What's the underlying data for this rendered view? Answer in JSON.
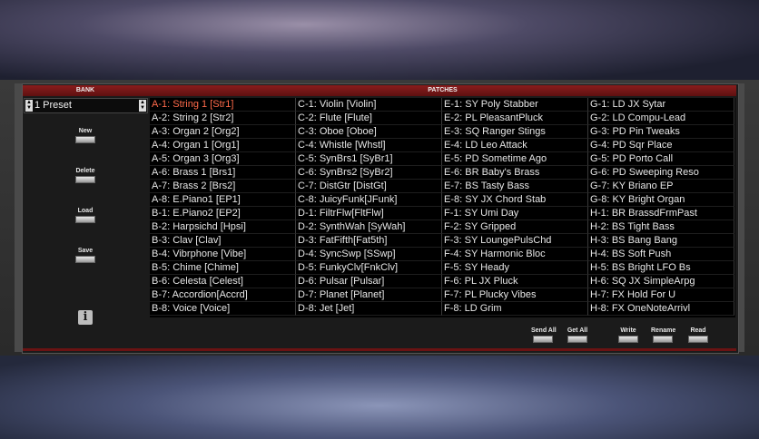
{
  "bank": {
    "header": "BANK",
    "selected_preset": "1 Preset",
    "buttons": {
      "new": "New",
      "delete": "Delete",
      "load": "Load",
      "save": "Save"
    }
  },
  "patches": {
    "header": "PATCHES",
    "selected": "A-1: String 1 [Str1]",
    "columns": [
      [
        "A-1: String 1 [Str1]",
        "A-2: String 2 [Str2]",
        "A-3: Organ 2 [Org2]",
        "A-4: Organ 1 [Org1]",
        "A-5: Organ 3 [Org3]",
        "A-6: Brass 1 [Brs1]",
        "A-7: Brass 2 [Brs2]",
        "A-8: E.Piano1 [EP1]",
        "B-1: E.Piano2 [EP2]",
        "B-2: Harpsichd [Hpsi]",
        "B-3: Clav [Clav]",
        "B-4: Vibrphone [Vibe]",
        "B-5: Chime [Chime]",
        "B-6: Celesta [Celest]",
        "B-7: Accordion[Accrd]",
        "B-8: Voice [Voice]"
      ],
      [
        "C-1: Violin [Violin]",
        "C-2: Flute [Flute]",
        "C-3: Oboe [Oboe]",
        "C-4: Whistle [Whstl]",
        "C-5: SynBrs1 [SyBr1]",
        "C-6: SynBrs2 [SyBr2]",
        "C-7: DistGtr [DistGt]",
        "C-8: JuicyFunk[JFunk]",
        "D-1: FiltrFlw[FltFlw]",
        "D-2: SynthWah [SyWah]",
        "D-3: FatFifth[Fat5th]",
        "D-4: SyncSwp [SSwp]",
        "D-5: FunkyClv[FnkClv]",
        "D-6: Pulsar [Pulsar]",
        "D-7: Planet [Planet]",
        "D-8: Jet [Jet]"
      ],
      [
        "E-1: SY Poly Stabber",
        "E-2: PL PleasantPluck",
        "E-3: SQ Ranger Stings",
        "E-4: LD Leo Attack",
        "E-5: PD Sometime Ago",
        "E-6: BR Baby's Brass",
        "E-7: BS Tasty Bass",
        "E-8: SY JX Chord Stab",
        "F-1: SY Umi Day",
        "F-2: SY Gripped",
        "F-3: SY LoungePulsChd",
        "F-4: SY Harmonic Bloc",
        "F-5: SY Heady",
        "F-6: PL JX Pluck",
        "F-7: PL Plucky Vibes",
        "F-8: LD Grim"
      ],
      [
        "G-1: LD JX Sytar",
        "G-2: LD Compu-Lead",
        "G-3: PD Pin Tweaks",
        "G-4: PD Sqr Place",
        "G-5: PD Porto Call",
        "G-6: PD Sweeping Reso",
        "G-7: KY Briano EP",
        "G-8: KY Bright Organ",
        "H-1: BR BrassdFrmPast",
        "H-2: BS Tight Bass",
        "H-3: BS Bang Bang",
        "H-4: BS Soft Push",
        "H-5: BS Bright LFO Bs",
        "H-6: SQ JX SimpleArpg",
        "H-7: FX Hold For U",
        "H-8: FX OneNoteArrivl"
      ]
    ]
  },
  "transfer": {
    "send_all": "Send All",
    "get_all": "Get All",
    "write": "Write",
    "rename": "Rename",
    "read": "Read"
  },
  "icons": {
    "info": "info-icon",
    "spin_up": "spin-up-icon",
    "spin_down": "spin-down-icon"
  },
  "colors": {
    "selected_patch": "#ff6a4a",
    "header_bar": "#8a1d1d"
  }
}
